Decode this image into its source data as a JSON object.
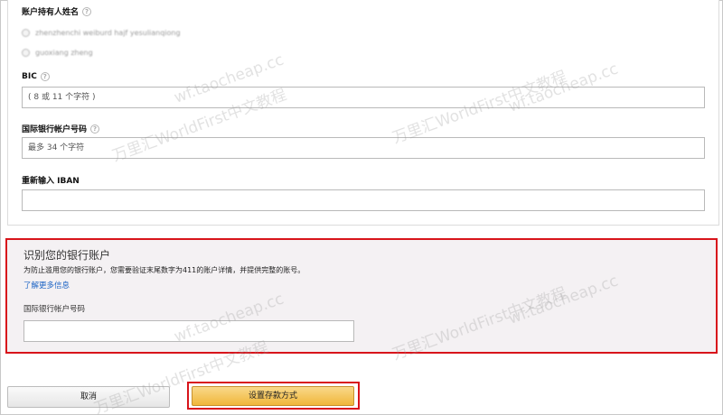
{
  "form": {
    "account_holder": {
      "label": "账户持有人姓名",
      "options": [
        "zhenzhenchi weiburd hajf yesulianqiong",
        "guoxiang zheng"
      ]
    },
    "bic": {
      "label": "BIC",
      "placeholder": "( 8 或 11 个字符 )"
    },
    "iban": {
      "label": "国际银行帐户号码",
      "placeholder": "最多 34 个字符"
    },
    "iban_confirm": {
      "label": "重新输入 IBAN",
      "placeholder": ""
    }
  },
  "verify": {
    "title": "识别您的银行账户",
    "description": "为防止滥用您的银行账户，您需要验证末尾数字为411的账户详情，并提供完整的账号。",
    "link": "了解更多信息",
    "field_label": "国际银行帐户号码",
    "placeholder": ""
  },
  "buttons": {
    "cancel": "取消",
    "submit": "设置存款方式"
  },
  "watermarks": [
    "万里汇WorldFirst中文教程",
    "wf.taocheap.cc"
  ]
}
